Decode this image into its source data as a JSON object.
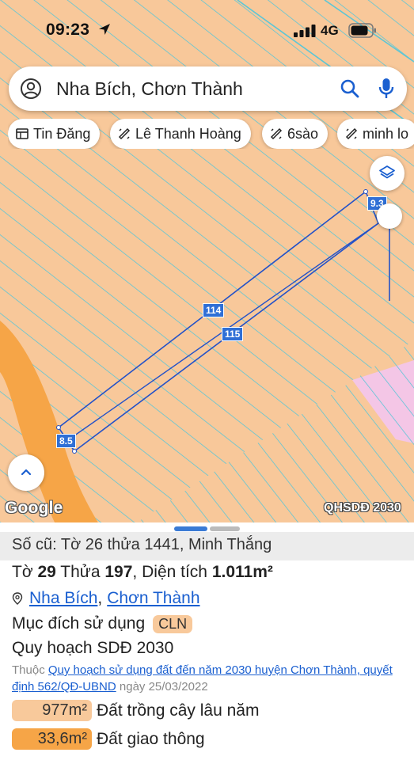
{
  "status_bar": {
    "time": "09:23",
    "network": "4G"
  },
  "search": {
    "query": "Nha Bích, Chơn Thành"
  },
  "chips": [
    {
      "label": "Tin Đăng",
      "icon": "table-icon"
    },
    {
      "label": "Lê Thanh Hoàng",
      "icon": "ruler-icon"
    },
    {
      "label": "6sào",
      "icon": "ruler-icon"
    },
    {
      "label": "minh lo",
      "icon": "ruler-icon"
    }
  ],
  "map": {
    "labels": {
      "plot_114": "114",
      "plot_115": "115",
      "edge_top": "9.3",
      "edge_bottom": "8.5"
    },
    "google_logo": "Google",
    "layer_tag": "QHSDĐ 2030",
    "colors": {
      "land": "#f8c89a",
      "road": "#f6a547",
      "grid": "#5cc6d6",
      "boundary": "#2452c8",
      "pink_zone": "#f4c6e6"
    }
  },
  "sheet": {
    "old_info": "Số cũ: Tờ 26 thửa 1441, Minh Thắng",
    "sheet_label": "Tờ",
    "sheet_no": "29",
    "parcel_label": "Thửa",
    "parcel_no": "197",
    "area_label": "Diện tích",
    "area_value": "1.011m²",
    "commune": "Nha Bích",
    "district": "Chơn Thành",
    "separator": ",",
    "purpose_label": "Mục đích sử dụng",
    "purpose_code": "CLN",
    "plan_title": "Quy hoạch SDĐ 2030",
    "plan_note_prefix": "Thuộc",
    "plan_note_link": "Quy hoạch sử dụng đất đến năm 2030 huyện Chơn Thành, quyết định 562/QĐ-UBND",
    "plan_note_date": "ngày 25/03/2022",
    "allocations": [
      {
        "area": "977m²",
        "use": "Đất trồng cây lâu năm",
        "color": "#f8c99b"
      },
      {
        "area": "33,6m²",
        "use": "Đất giao thông",
        "color": "#f6a547"
      }
    ]
  }
}
